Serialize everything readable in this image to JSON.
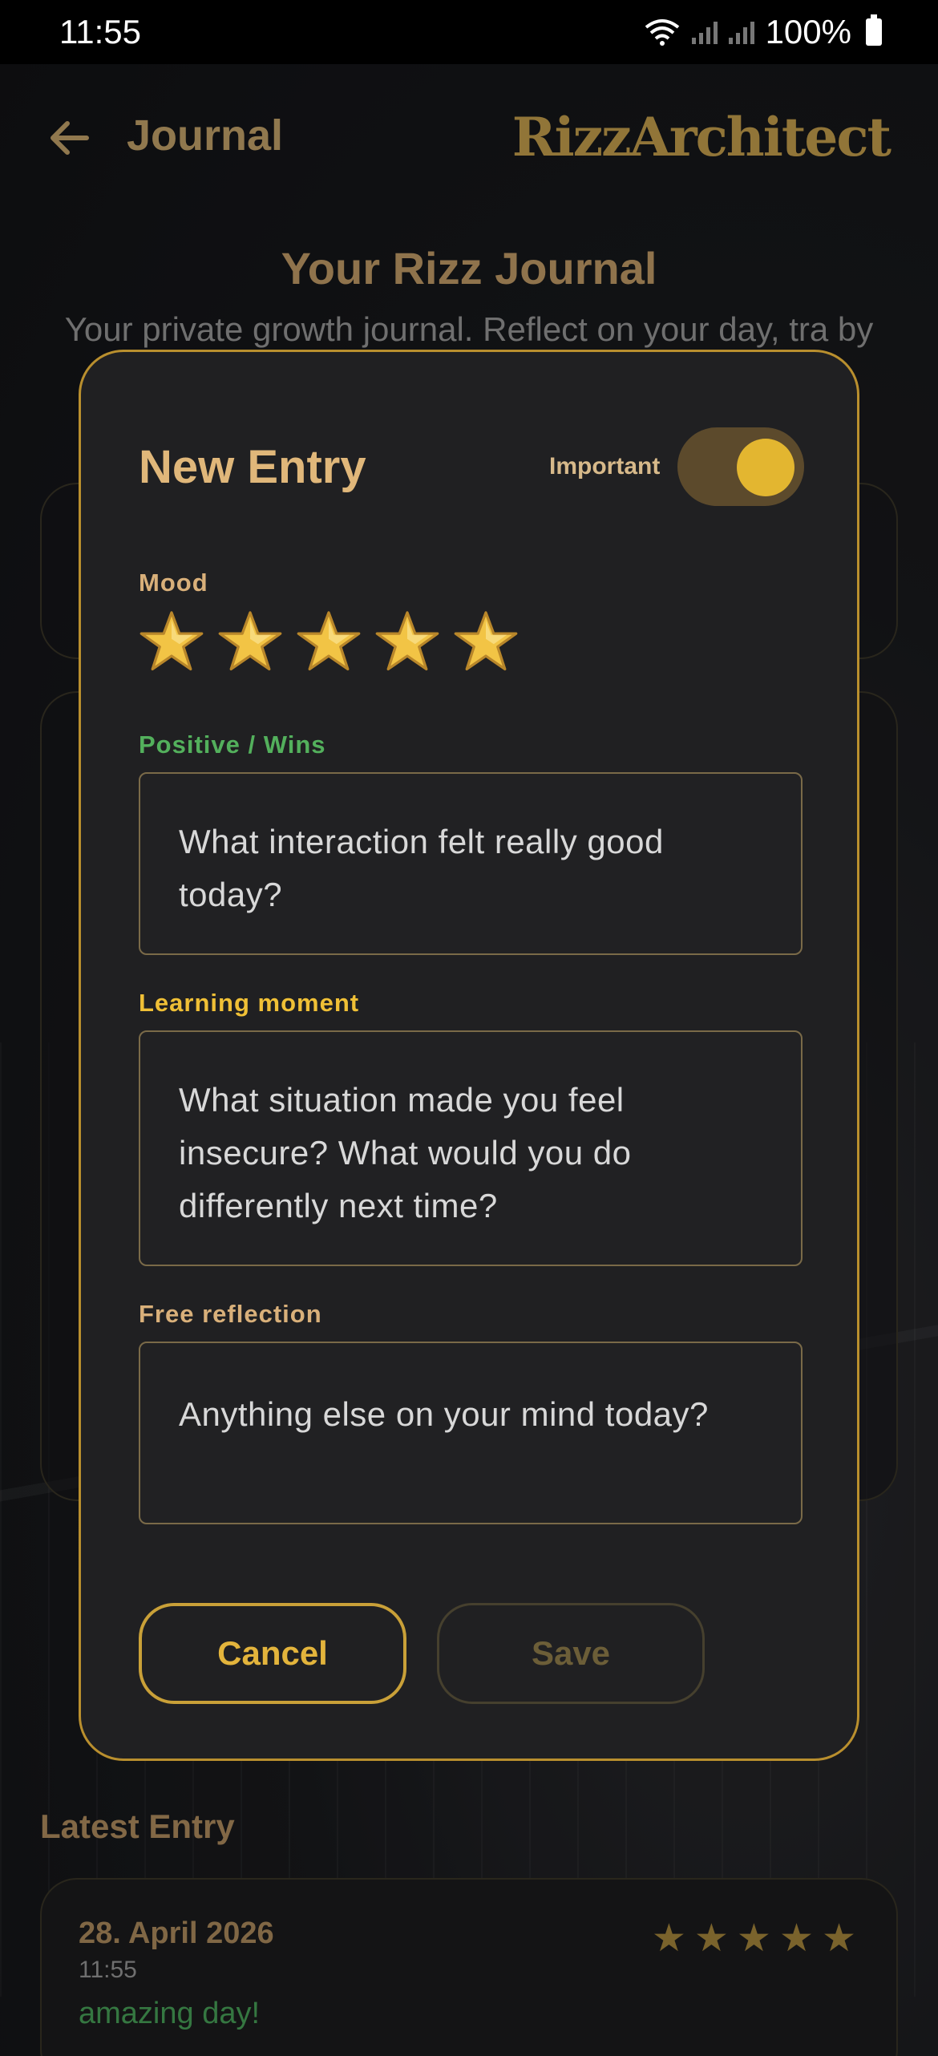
{
  "status_bar": {
    "time": "11:55",
    "battery": "100%"
  },
  "header": {
    "title": "Journal",
    "brand": "RizzArchitect"
  },
  "page": {
    "title": "Your Rizz Journal",
    "subtitle": "Your private growth journal. Reflect on your day, tra by"
  },
  "modal": {
    "title": "New Entry",
    "important_label": "Important",
    "important_on": true,
    "mood_label": "Mood",
    "mood_rating": 5,
    "mood_max": 5,
    "positive_label": "Positive / Wins",
    "positive_placeholder": "What interaction felt really good today?",
    "learning_label": "Learning moment",
    "learning_placeholder": "What situation made you feel insecure? What would you do differently next time?",
    "free_label": "Free reflection",
    "free_placeholder": "Anything else on your mind today?",
    "cancel_label": "Cancel",
    "save_label": "Save"
  },
  "latest": {
    "heading": "Latest Entry",
    "date": "28. April 2026",
    "time": "11:55",
    "text": "amazing day!",
    "rating": 5
  },
  "colors": {
    "accent_gold": "#c9a038",
    "positive_green": "#53b05c",
    "learning_yellow": "#f0c036",
    "modal_bg": "#202022"
  },
  "icons": [
    "back-arrow-icon",
    "wifi-icon",
    "signal-icon",
    "battery-icon",
    "star-icon"
  ]
}
